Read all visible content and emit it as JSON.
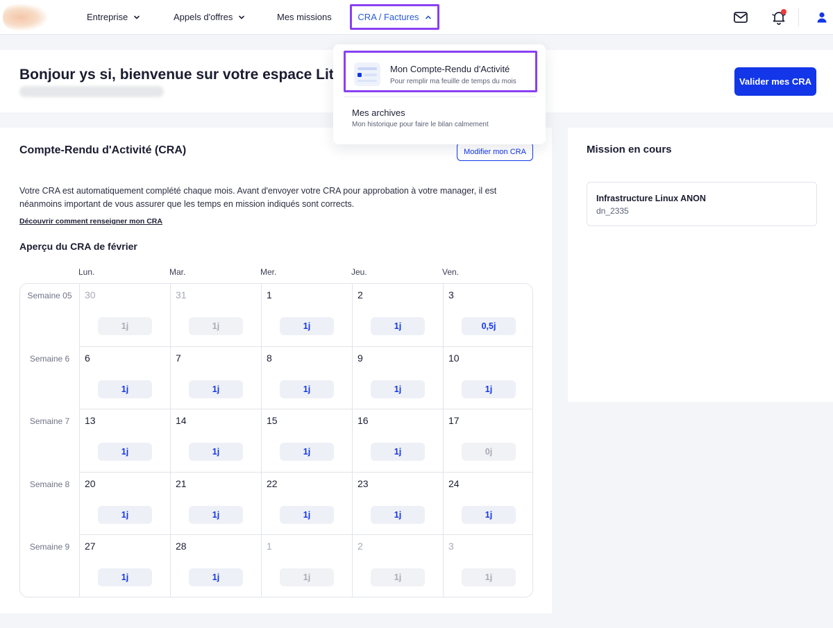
{
  "nav": {
    "items": [
      {
        "label": "Entreprise",
        "icon": "chevron-down-icon"
      },
      {
        "label": "Appels d'offres",
        "icon": "chevron-down-icon"
      },
      {
        "label": "Mes missions"
      }
    ],
    "active": {
      "label": "CRA / Factures",
      "icon": "chevron-up-icon"
    },
    "icons": [
      "mail-icon",
      "bell-icon",
      "user-icon"
    ],
    "accent": "#8a3ff2",
    "link_color": "#2a5bd7"
  },
  "greeting": {
    "title": "Bonjour ys si, bienvenue sur votre espace Little",
    "button": "Valider mes CRA"
  },
  "dropdown": {
    "items": [
      {
        "title": "Mon Compte-Rendu d'Activité",
        "subtitle": "Pour remplir ma feuille de temps du mois"
      },
      {
        "title": "Mes archives",
        "subtitle": "Mon historique pour faire le bilan calmement"
      }
    ]
  },
  "cra": {
    "title": "Compte-Rendu d'Activité (CRA)",
    "edit_button": "Modifier mon CRA",
    "description": "Votre CRA est automatiquement complété chaque mois. Avant d'envoyer votre CRA pour approbation à votre manager, il est néanmoins important de vous assurer que les temps en mission indiqués sont corrects.",
    "link": "Découvrir comment renseigner mon CRA",
    "preview_title": "Aperçu du CRA de février",
    "days": [
      "Lun.",
      "Mar.",
      "Mer.",
      "Jeu.",
      "Ven."
    ],
    "weeks": [
      {
        "label": "Semaine 05",
        "cells": [
          {
            "num": "30",
            "value": "1j",
            "dim": true
          },
          {
            "num": "31",
            "value": "1j",
            "dim": true
          },
          {
            "num": "1",
            "value": "1j"
          },
          {
            "num": "2",
            "value": "1j"
          },
          {
            "num": "3",
            "value": "0,5j"
          }
        ]
      },
      {
        "label": "Semaine 6",
        "cells": [
          {
            "num": "6",
            "value": "1j"
          },
          {
            "num": "7",
            "value": "1j"
          },
          {
            "num": "8",
            "value": "1j"
          },
          {
            "num": "9",
            "value": "1j"
          },
          {
            "num": "10",
            "value": "1j"
          }
        ]
      },
      {
        "label": "Semaine 7",
        "cells": [
          {
            "num": "13",
            "value": "1j"
          },
          {
            "num": "14",
            "value": "1j"
          },
          {
            "num": "15",
            "value": "1j"
          },
          {
            "num": "16",
            "value": "1j"
          },
          {
            "num": "17",
            "value": "0j",
            "zero": true
          }
        ]
      },
      {
        "label": "Semaine 8",
        "cells": [
          {
            "num": "20",
            "value": "1j"
          },
          {
            "num": "21",
            "value": "1j"
          },
          {
            "num": "22",
            "value": "1j"
          },
          {
            "num": "23",
            "value": "1j"
          },
          {
            "num": "24",
            "value": "1j"
          }
        ]
      },
      {
        "label": "Semaine 9",
        "cells": [
          {
            "num": "27",
            "value": "1j"
          },
          {
            "num": "28",
            "value": "1j"
          },
          {
            "num": "1",
            "value": "1j",
            "dim": true
          },
          {
            "num": "2",
            "value": "1j",
            "dim": true
          },
          {
            "num": "3",
            "value": "1j",
            "dim": true
          }
        ]
      }
    ],
    "accent": "#1236e8"
  },
  "mission": {
    "title": "Mission en cours",
    "name": "Infrastructure Linux ANON",
    "code": "dn_2335"
  }
}
